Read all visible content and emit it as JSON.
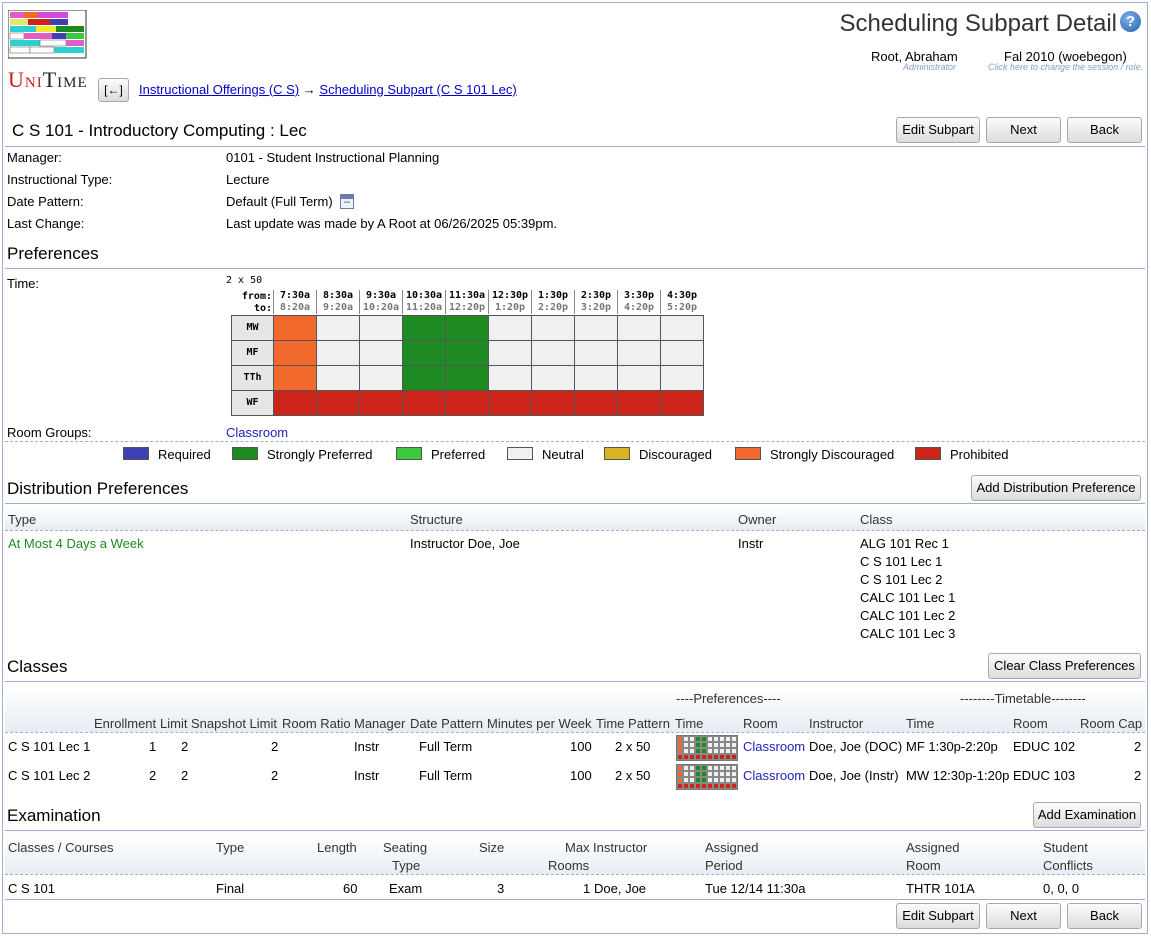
{
  "header": {
    "title": "Scheduling Subpart Detail",
    "help_icon": "help-icon",
    "logo_text": "UniTime",
    "user_name": "Root, Abraham",
    "user_role": "Administrator",
    "session": "Fal 2010 (woebegon)",
    "session_hint": "Click here to change the session / role.",
    "back_arrow": "[←]",
    "breadcrumb_1": "Instructional Offerings (C S)",
    "breadcrumb_sep": "→",
    "breadcrumb_2": "Scheduling Subpart (C S 101 Lec)"
  },
  "subpart": {
    "title": "C S 101 - Introductory Computing : Lec",
    "edit_label": "Edit Subpart",
    "next_label": "Next",
    "back_label": "Back",
    "manager_label": "Manager:",
    "manager_value": "0101 - Student Instructional Planning",
    "type_label": "Instructional Type:",
    "type_value": "Lecture",
    "date_label": "Date Pattern:",
    "date_value": "Default (Full Term)",
    "change_label": "Last Change:",
    "change_value": "Last update was made by A Root at 06/26/2025 05:39pm."
  },
  "preferences": {
    "title": "Preferences",
    "time_label": "Time:",
    "time_pattern": "2 x 50",
    "from_label": "from:",
    "to_label": "to:",
    "columns": [
      {
        "from": "7:30a",
        "to": "8:20a"
      },
      {
        "from": "8:30a",
        "to": "9:20a"
      },
      {
        "from": "9:30a",
        "to": "10:20a"
      },
      {
        "from": "10:30a",
        "to": "11:20a"
      },
      {
        "from": "11:30a",
        "to": "12:20p"
      },
      {
        "from": "12:30p",
        "to": "1:20p"
      },
      {
        "from": "1:30p",
        "to": "2:20p"
      },
      {
        "from": "2:30p",
        "to": "3:20p"
      },
      {
        "from": "3:30p",
        "to": "4:20p"
      },
      {
        "from": "4:30p",
        "to": "5:20p"
      }
    ],
    "rows": [
      {
        "day": "MW",
        "cells": [
          "SD",
          "N",
          "N",
          "SP",
          "SP",
          "N",
          "N",
          "N",
          "N",
          "N"
        ]
      },
      {
        "day": "MF",
        "cells": [
          "SD",
          "N",
          "N",
          "SP",
          "SP",
          "N",
          "N",
          "N",
          "N",
          "N"
        ]
      },
      {
        "day": "TTh",
        "cells": [
          "SD",
          "N",
          "N",
          "SP",
          "SP",
          "N",
          "N",
          "N",
          "N",
          "N"
        ]
      },
      {
        "day": "WF",
        "cells": [
          "P",
          "P",
          "P",
          "P",
          "P",
          "P",
          "P",
          "P",
          "P",
          "P"
        ]
      }
    ],
    "room_groups_label": "Room Groups:",
    "room_groups_value": "Classroom",
    "legend": [
      {
        "key": "R",
        "label": "Required",
        "color": "#3f3fb4"
      },
      {
        "key": "SP",
        "label": "Strongly Preferred",
        "color": "#1d8b22"
      },
      {
        "key": "PR",
        "label": "Preferred",
        "color": "#3cc93c"
      },
      {
        "key": "N",
        "label": "Neutral",
        "color": "#f0f0f0"
      },
      {
        "key": "D",
        "label": "Discouraged",
        "color": "#dab322"
      },
      {
        "key": "SD",
        "label": "Strongly Discouraged",
        "color": "#f2692e"
      },
      {
        "key": "P",
        "label": "Prohibited",
        "color": "#cc2419"
      }
    ]
  },
  "distribution": {
    "title": "Distribution Preferences",
    "add_label": "Add Distribution Preference",
    "headers": {
      "type": "Type",
      "structure": "Structure",
      "owner": "Owner",
      "class": "Class"
    },
    "row": {
      "type": "At Most 4 Days a Week",
      "structure": "Instructor Doe, Joe",
      "owner": "Instr",
      "classes": [
        "ALG 101 Rec 1",
        "C S 101 Lec 1",
        "C S 101 Lec 2",
        "CALC 101 Lec 1",
        "CALC 101 Lec 2",
        "CALC 101 Lec 3"
      ]
    }
  },
  "classes": {
    "title": "Classes",
    "clear_label": "Clear Class Preferences",
    "group_prefs": "----Preferences----",
    "group_timetable": "--------Timetable--------",
    "headers": {
      "enrollment": "Enrollment",
      "limit": "Limit",
      "snapshot": "Snapshot Limit",
      "ratio": "Room Ratio",
      "manager": "Manager",
      "date_pattern": "Date Pattern",
      "minutes": "Minutes per Week",
      "time_pattern": "Time Pattern",
      "time": "Time",
      "room": "Room",
      "instructor": "Instructor",
      "tt_time": "Time",
      "tt_room": "Room",
      "room_cap": "Room Cap"
    },
    "rows": [
      {
        "name": "C S 101 Lec 1",
        "enrollment": "1",
        "limit": "2",
        "ratio": "2",
        "manager": "Instr",
        "date_pattern": "Full Term",
        "minutes": "100",
        "time_pattern": "2 x 50",
        "room": "Classroom",
        "instructor": "Doe, Joe (DOC)",
        "tt_time": "MF 1:30p-2:20p",
        "tt_room": "EDUC 102",
        "room_cap": "2"
      },
      {
        "name": "C S 101 Lec 2",
        "enrollment": "2",
        "limit": "2",
        "ratio": "2",
        "manager": "Instr",
        "date_pattern": "Full Term",
        "minutes": "100",
        "time_pattern": "2 x 50",
        "room": "Classroom",
        "instructor": "Doe, Joe (Instr)",
        "tt_time": "MW 12:30p-1:20p",
        "tt_room": "EDUC 103",
        "room_cap": "2"
      }
    ]
  },
  "examination": {
    "title": "Examination",
    "add_label": "Add Examination",
    "headers": {
      "classes": "Classes / Courses",
      "type": "Type",
      "length": "Length",
      "seating1": "Seating",
      "seating2": "Type",
      "size": "Size",
      "max1": "Max",
      "max2": "Rooms",
      "instructor": "Instructor",
      "period1": "Assigned",
      "period2": "Period",
      "room1": "Assigned",
      "room2": "Room",
      "conf1": "Student",
      "conf2": "Conflicts"
    },
    "row": {
      "classes": "C S 101",
      "type": "Final",
      "length": "60",
      "seating": "Exam",
      "size": "3",
      "max_rooms": "1",
      "instructor": "Doe, Joe",
      "period": "Tue 12/14 11:30a",
      "room": "THTR 101A",
      "conflicts": "0, 0, 0"
    }
  },
  "footer": {
    "edit_label": "Edit Subpart",
    "next_label": "Next",
    "back_label": "Back"
  }
}
